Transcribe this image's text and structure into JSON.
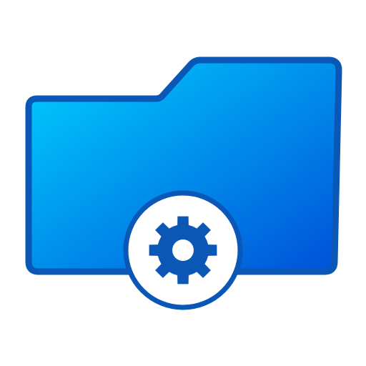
{
  "icon": {
    "name": "folder-settings-icon",
    "colors": {
      "folder_fill_start": "#00CFFF",
      "folder_fill_end": "#0050D8",
      "folder_stroke": "#0A57B5",
      "gear_badge_fill": "#FFFFFF",
      "gear_badge_stroke": "#0A57B5",
      "gear_fill": "#0A57B5"
    }
  }
}
